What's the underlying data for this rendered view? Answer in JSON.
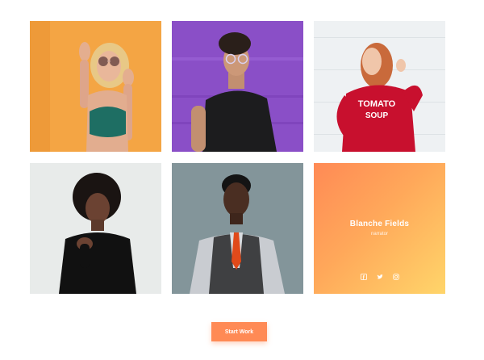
{
  "gallery": {
    "photos": [
      {
        "alt": "woman-with-sunglasses-portrait",
        "bg": "#f3a03e"
      },
      {
        "alt": "man-with-glasses-portrait",
        "bg": "#8a4fc7"
      },
      {
        "alt": "woman-red-sweater-portrait",
        "bg": "#eceff1",
        "sweater_text_1": "TOMATO",
        "sweater_text_2": "SOUP"
      },
      {
        "alt": "woman-black-top-portrait",
        "bg": "#e8ebea"
      },
      {
        "alt": "man-vest-tie-portrait",
        "bg": "#7f9196"
      }
    ],
    "profile": {
      "name": "Blanche Fields",
      "role": "narrator",
      "socials": [
        "facebook-icon",
        "twitter-icon",
        "instagram-icon"
      ]
    }
  },
  "cta": {
    "label": "Start Work",
    "color": "#ff8a55"
  }
}
